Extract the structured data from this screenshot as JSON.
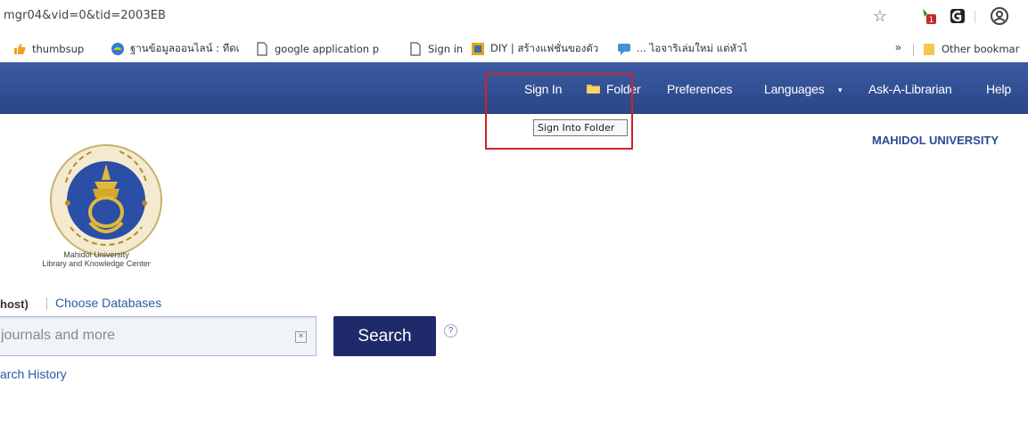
{
  "browser": {
    "url": "mgr04&vid=0&tid=2003EB",
    "icons": [
      "star-icon",
      "extension-icon",
      "extension-icon",
      "profile-icon"
    ],
    "ext_badge": "1",
    "bookmarks": [
      {
        "label": "thumbsup",
        "icon": "thumbs-up-icon"
      },
      {
        "label": "ฐานข้อมูลออนไลน์ : ทีดเ",
        "icon": "globe-icon"
      },
      {
        "label": "google application p",
        "icon": "page-icon"
      },
      {
        "label": "Sign in",
        "icon": "page-icon"
      },
      {
        "label": "DIY | สร้างแฟชั่นของตัว",
        "icon": "diy-icon"
      },
      {
        "label": "... ไอจาริเล่มใหม่ แต่หัวไ",
        "icon": "chat-icon"
      }
    ],
    "bookmarks_more": "»",
    "other_bookmarks": "Other bookmar"
  },
  "nav": {
    "sign_in": "Sign In",
    "folder": "Folder",
    "preferences": "Preferences",
    "languages": "Languages",
    "languages_caret": "▾",
    "ask": "Ask-A-Librarian",
    "help": "Help",
    "bg_color": "#2f4b8f"
  },
  "tooltip": "Sign Into Folder",
  "university": "MAHIDOL UNIVERSITY",
  "logo": {
    "line1": "Mahidol University",
    "line2": "Library and Knowledge Center"
  },
  "databases": {
    "current": "host)",
    "choose": "Choose Databases"
  },
  "search": {
    "placeholder": "journals and more",
    "clear": "×",
    "button": "Search",
    "help": "?",
    "history": "arch History"
  },
  "colors": {
    "accent": "#2b4a96",
    "highlight": "#d0222a",
    "button": "#1f2a6a"
  }
}
